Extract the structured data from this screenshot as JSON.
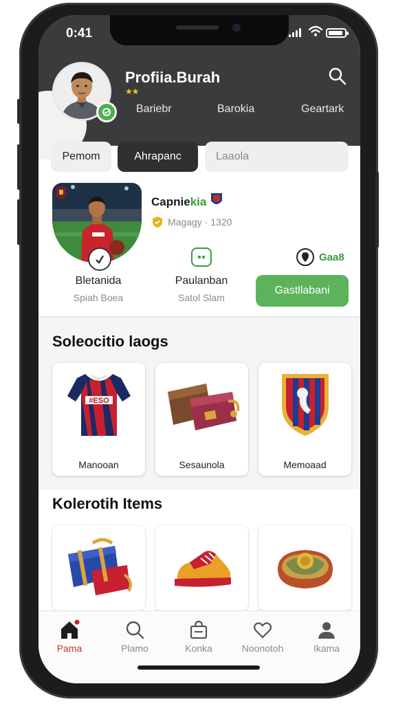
{
  "status_bar": {
    "time": "0:41"
  },
  "header": {
    "profile_name": "Profiia.Burah",
    "stars": "★★",
    "tabs": [
      "Bariebr",
      "Barokia",
      "Geartark"
    ]
  },
  "filters": [
    {
      "label": "Pemom"
    },
    {
      "label": "Ahrapanc"
    },
    {
      "placeholder": "Laaola"
    }
  ],
  "player_card": {
    "club_name_dark": "Capnie",
    "club_name_green": "kia",
    "meta": "Magagy · 1320",
    "stats": [
      {
        "label": "Bletanida",
        "sub": "Spiah Boea"
      },
      {
        "label": "Paulanban",
        "sub": "Satol Slam"
      }
    ],
    "score": "Gaa8",
    "cta_label": "Gastllabani"
  },
  "section_1": {
    "title": "Soleocitio laogs",
    "items": [
      {
        "label": "Manooan",
        "icon": "jersey-icon"
      },
      {
        "label": "Sesaunola",
        "icon": "bag-icon"
      },
      {
        "label": "Memoaad",
        "icon": "crest-icon"
      }
    ]
  },
  "section_2": {
    "title": "Kolerotih Items",
    "items": [
      {
        "icon": "luggage-icon"
      },
      {
        "icon": "boot-icon"
      },
      {
        "icon": "amulet-icon"
      }
    ]
  },
  "bottom_nav": [
    {
      "label": "Pama",
      "icon": "home-icon",
      "active": true
    },
    {
      "label": "Plamo",
      "icon": "search-icon",
      "active": false
    },
    {
      "label": "Konka",
      "icon": "shop-icon",
      "active": false
    },
    {
      "label": "Noonotoh",
      "icon": "heart-icon",
      "active": false
    },
    {
      "label": "Ikama",
      "icon": "profile-icon",
      "active": false
    }
  ],
  "colors": {
    "accent_green": "#5cb35c",
    "header_bg": "#3b3b3d",
    "active_nav": "#c0392b"
  }
}
